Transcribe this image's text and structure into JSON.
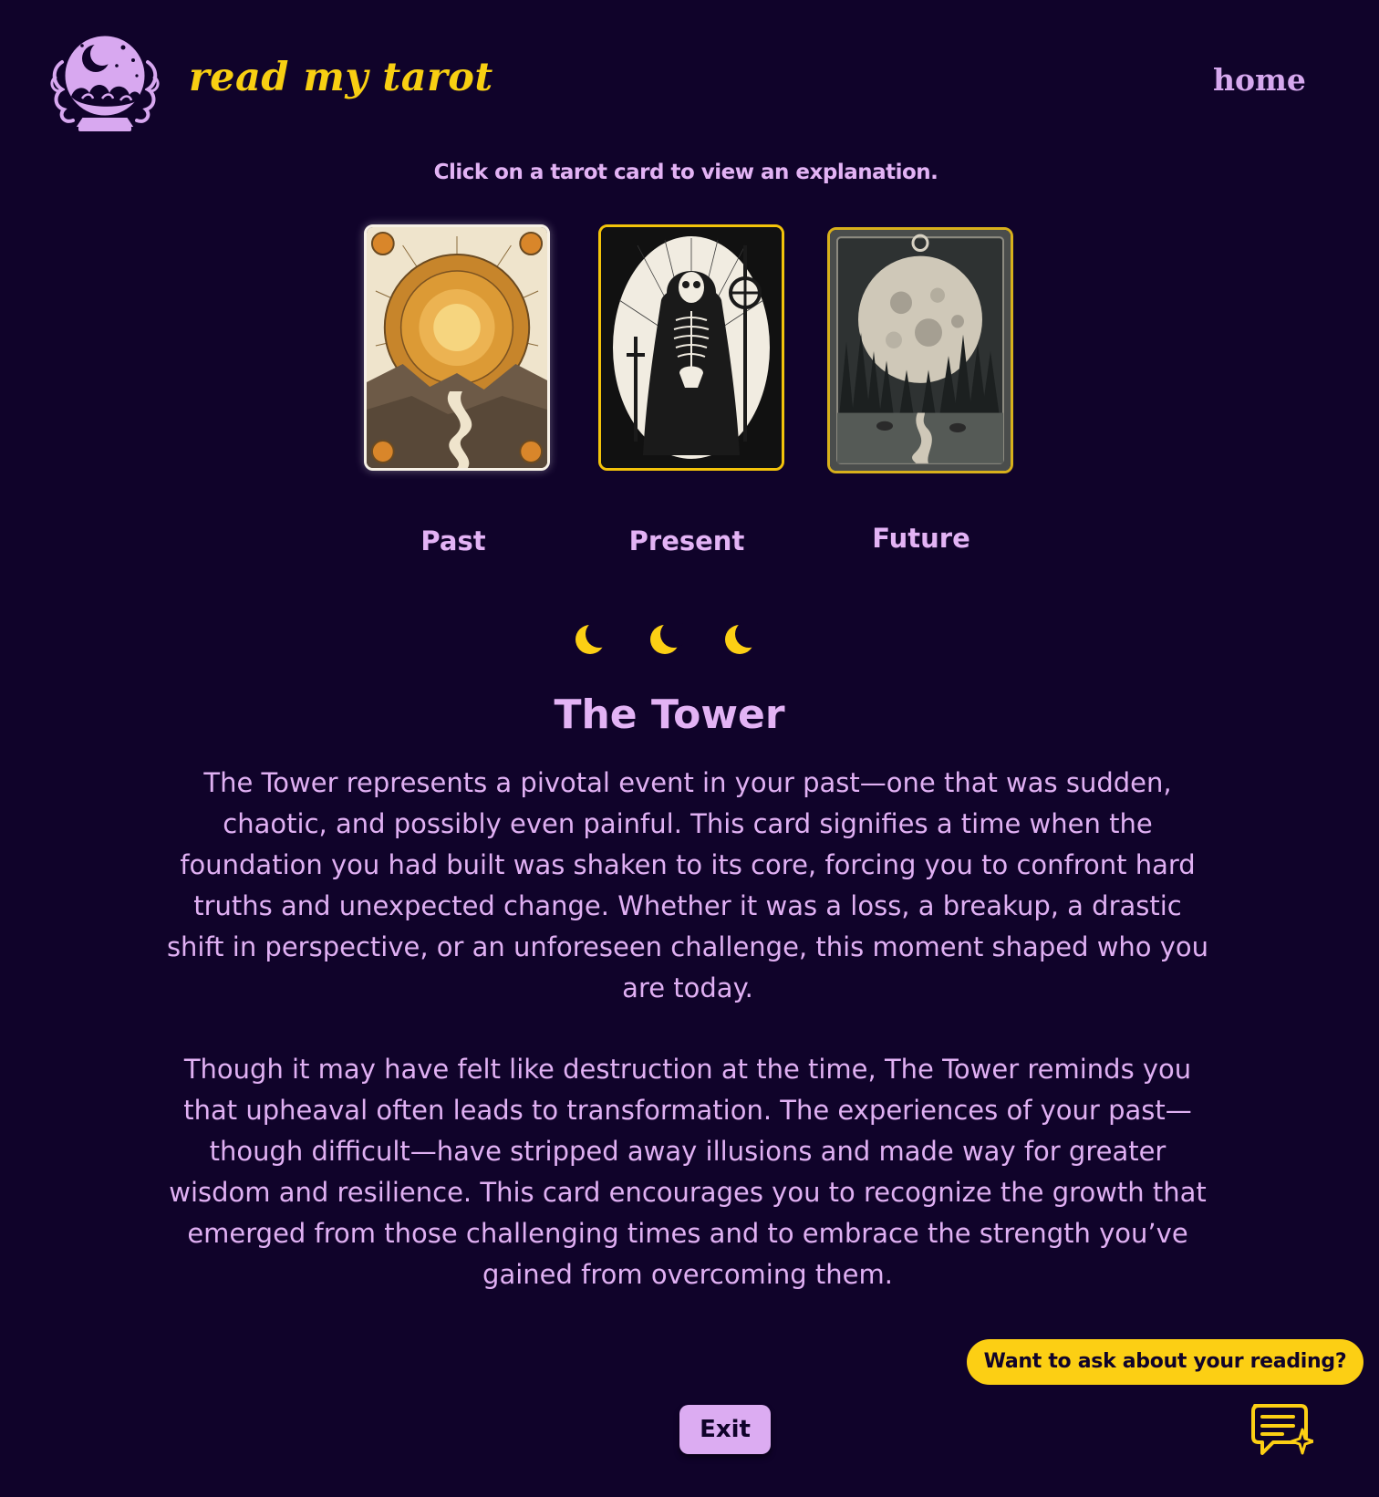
{
  "header": {
    "brand": "read my tarot",
    "nav_home": "home",
    "logo_icon": "crystal-ball-icon"
  },
  "instruction": "Click on a tarot card to view an explanation.",
  "cards": [
    {
      "label": "Past",
      "image": "sun-card-image"
    },
    {
      "label": "Present",
      "image": "death-card-image"
    },
    {
      "label": "Future",
      "image": "moon-card-image"
    }
  ],
  "divider_icon": "crescent-moon-icon",
  "reading": {
    "title": "The Tower",
    "paragraphs": [
      "The Tower represents a pivotal event in your past—one that was sudden, chaotic, and possibly even painful. This card signifies a time when the foundation you had built was shaken to its core, forcing you to confront hard truths and unexpected change. Whether it was a loss, a breakup, a drastic shift in perspective, or an unforeseen challenge, this moment shaped who you are today.",
      "Though it may have felt like destruction at the time, The Tower reminds you that upheaval often leads to transformation. The experiences of your past—though difficult—have stripped away illusions and made way for greater wisdom and resilience. This card encourages you to recognize the growth that emerged from those challenging times and to embrace the strength you’ve gained from overcoming them."
    ]
  },
  "chat": {
    "prompt": "Want to ask about your reading?",
    "icon": "chat-sparkle-icon"
  },
  "exit_label": "Exit",
  "colors": {
    "background": "#10032a",
    "accent_yellow": "#fccf14",
    "lavender": "#e3b3f5",
    "button": "#dcacf2"
  }
}
